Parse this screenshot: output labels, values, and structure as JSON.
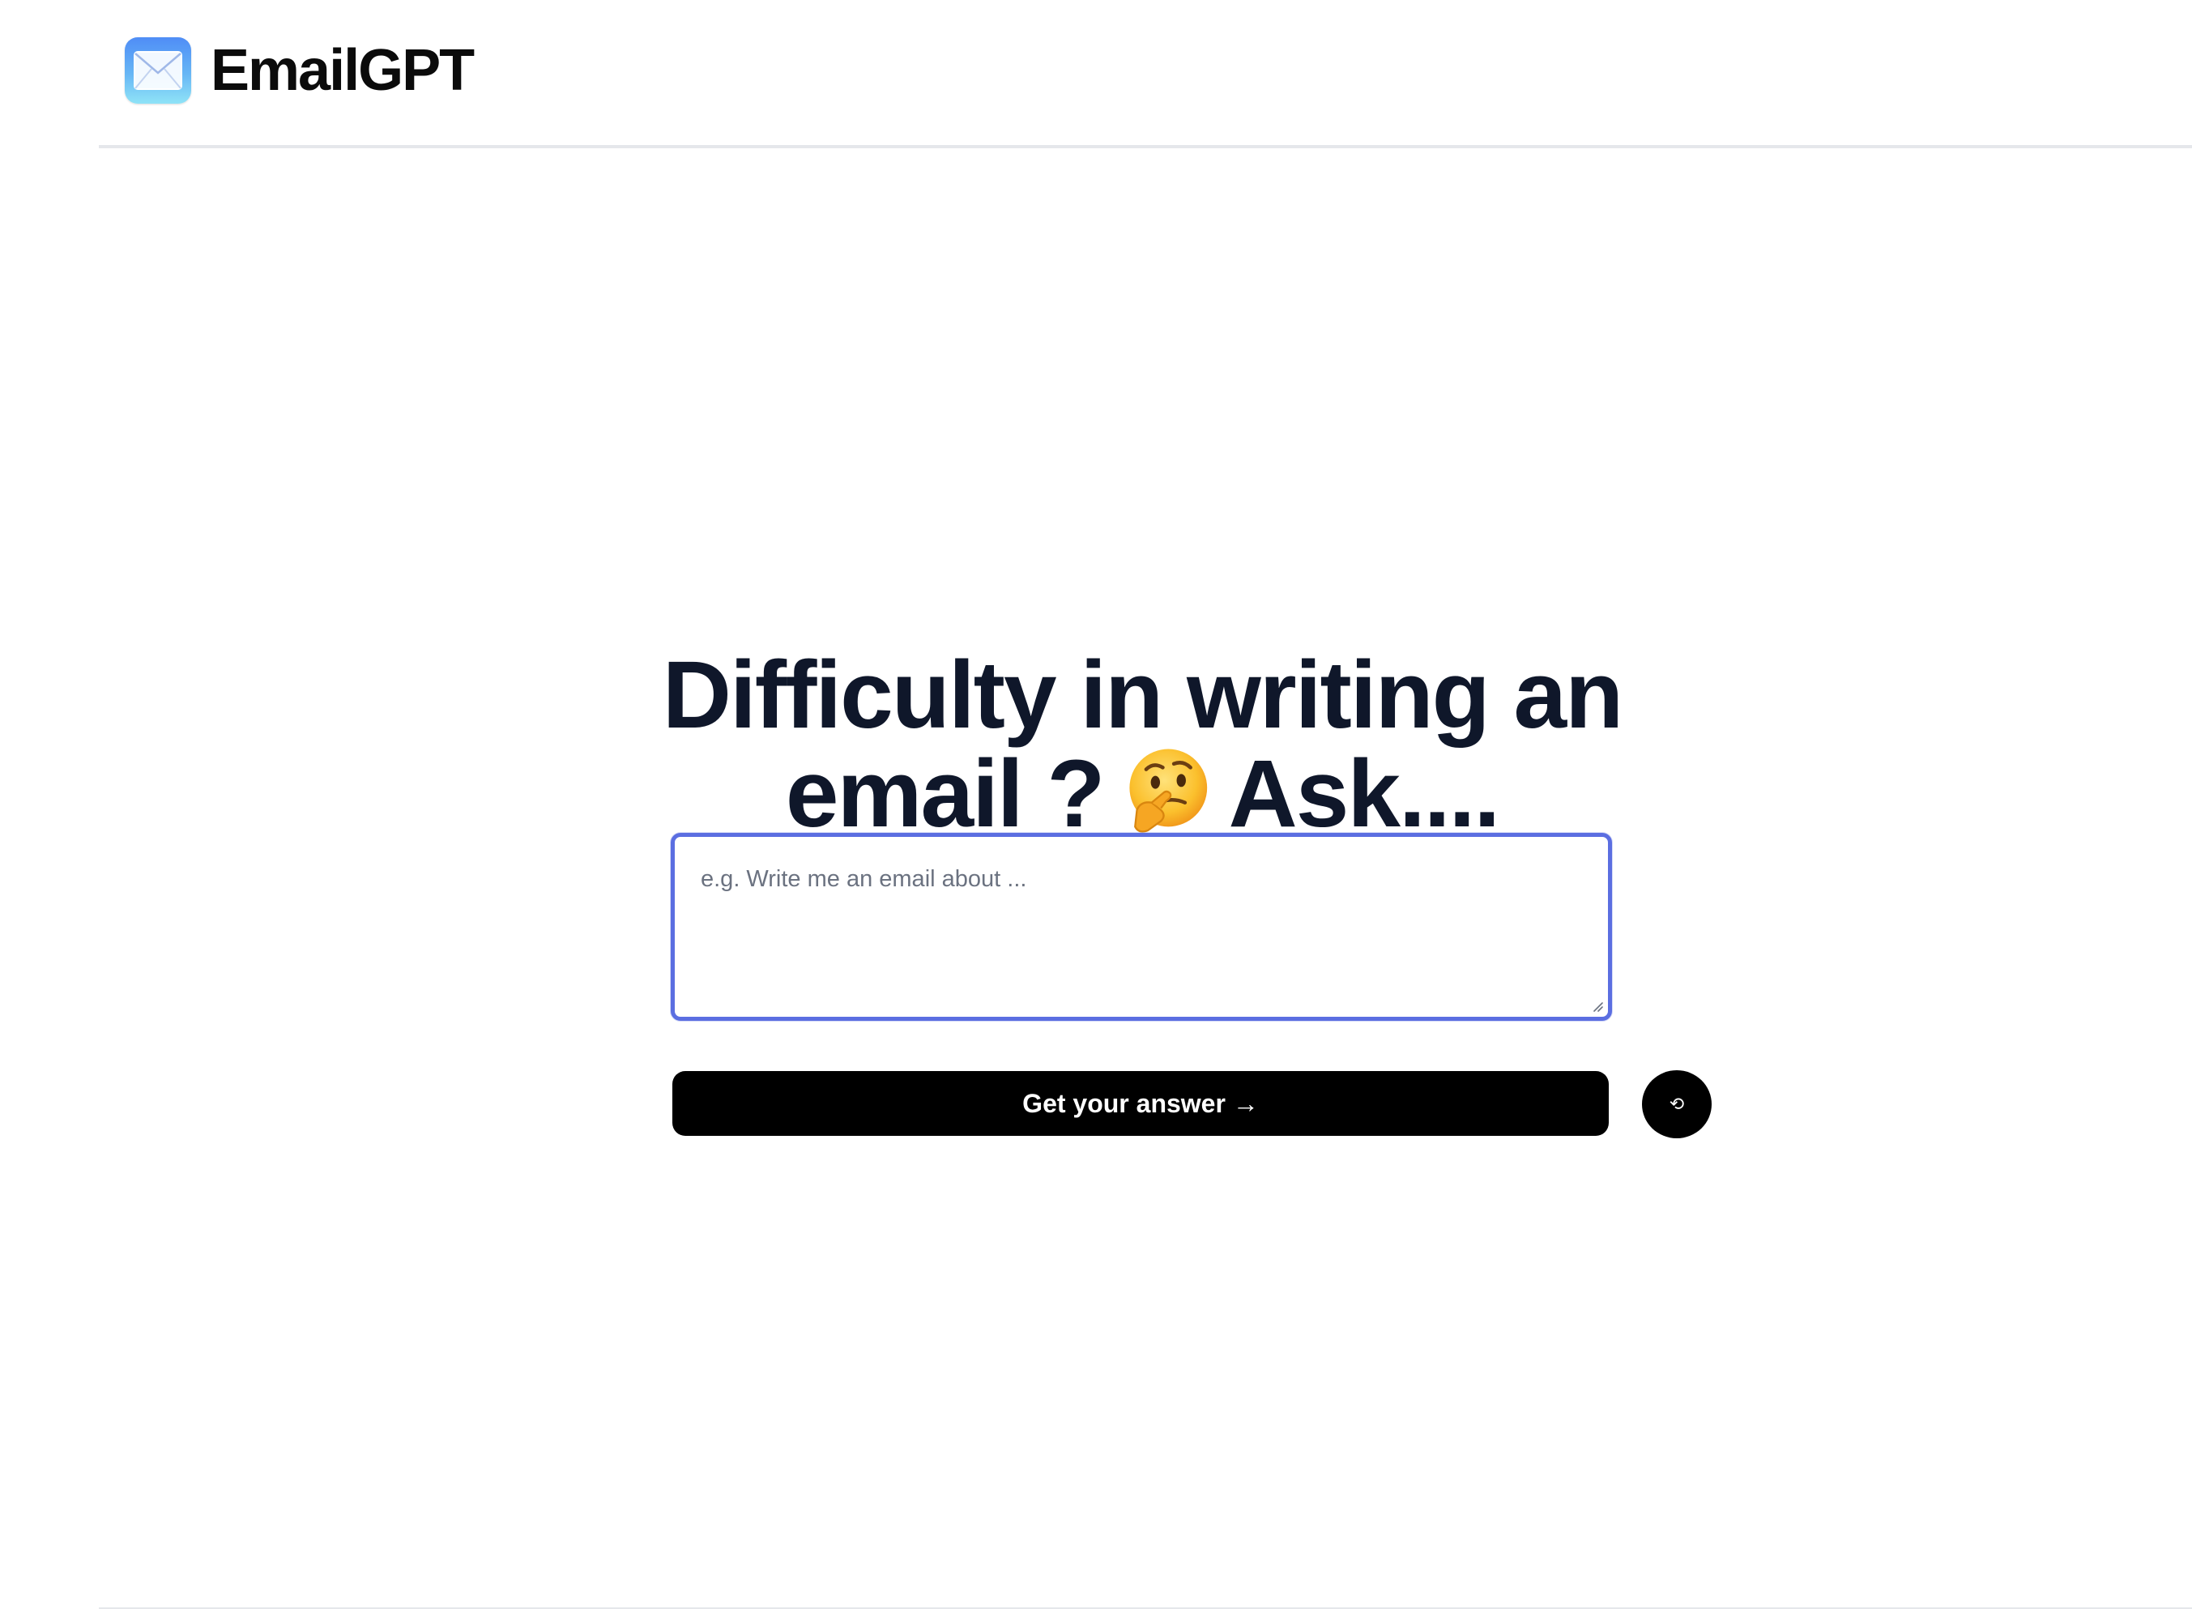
{
  "header": {
    "brand": "EmailGPT",
    "logo_icon": "mail-envelope-icon"
  },
  "hero": {
    "line1": "Difficulty in writing an",
    "line2_start": "email ?",
    "emoji": "thinking-face",
    "line2_end": "Ask...."
  },
  "prompt": {
    "placeholder": "e.g. Write me an email about ...",
    "value": ""
  },
  "actions": {
    "submit_label": "Get your answer →",
    "reset_label": "⟲"
  },
  "colors": {
    "focus_ring": "#5b6ee1",
    "button_bg": "#000000",
    "heading": "#0f172a"
  }
}
